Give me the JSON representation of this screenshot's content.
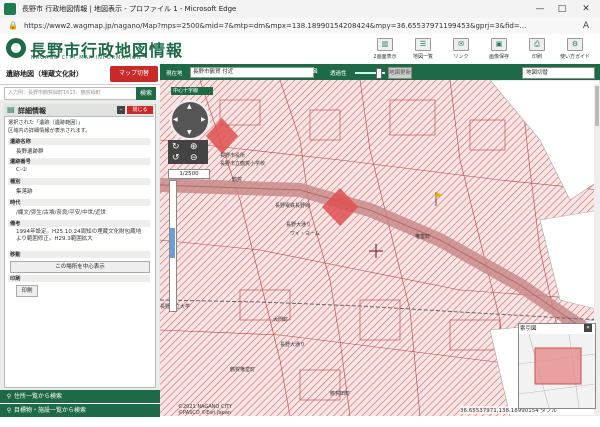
{
  "window": {
    "title": "長野市 行政地図情報 | 地図表示 - プロファイル 1 - Microsoft Edge",
    "minimize": "—",
    "maximize": "□",
    "close": "✕"
  },
  "address_bar": {
    "url": "https://www2.wagmap.jp/nagano/Map?mps=2500&mid=7&mtp=dm&mpx=138.18990154208424&mpy=36.65537971199453&gprj=3&fid=..."
  },
  "header": {
    "logo_title": "長野市行政地図情報",
    "logo_sub": "NAGANO CITY MAP INFORMATION",
    "buttons": [
      {
        "label": "2画面表示",
        "icon": "split-screen-icon"
      },
      {
        "label": "地図一覧",
        "icon": "map-list-icon"
      },
      {
        "label": "リンク",
        "icon": "link-icon"
      },
      {
        "label": "画像保存",
        "icon": "image-save-icon"
      },
      {
        "label": "印刷",
        "icon": "print-icon"
      },
      {
        "label": "使い方ガイド",
        "icon": "guide-icon"
      }
    ]
  },
  "left": {
    "map_type": "遺跡地図（埋蔵文化財）",
    "map_switch": "マップ切替",
    "search_placeholder": "入力例：長野市鶴賀緑町1613、鶴賀緑町",
    "search_button": "検索",
    "detail": {
      "title": "詳細情報",
      "close": "閉じる",
      "intro1": "選択された「遺跡（遺跡範囲）」",
      "intro2": "区域内の詳細情報が表示されます。",
      "fields": [
        {
          "label": "遺跡名称",
          "value": "長野遺跡群"
        },
        {
          "label": "遺跡番号",
          "value": "C-②"
        },
        {
          "label": "種別",
          "value": "集落跡"
        },
        {
          "label": "時代",
          "value": "/縄文/弥生/古墳/奈良/平安/中世/近世"
        },
        {
          "label": "備考",
          "value": "1994年設定。H25.10.24周知の埋蔵文化財包蔵地より範囲修正。H29.3範囲拡大"
        }
      ],
      "move_label": "移動",
      "center_button": "この場所を中心表示",
      "print_label": "印刷",
      "print_button": "印刷"
    },
    "bottom_items": [
      "住所一覧から検索",
      "目標物・施設一覧から検索"
    ]
  },
  "maptools": {
    "addr_label": "現在地",
    "addr_value": "長野市鶴賀 付近",
    "opacity_label": "透過性",
    "display_button": "地図更新",
    "base_select": "地図切替",
    "city_label": "中心十字線",
    "scale": "1/2500"
  },
  "map": {
    "labels": [
      "長野市役所",
      "鶴賀",
      "長野市立鶴賀小学校",
      "長野電鉄長野線",
      "長野大通り",
      "ワイ・ヨーム",
      "長野県立大学",
      "大門町",
      "長野大通り",
      "権堂町",
      "鶴賀権堂町",
      "鶴賀田町"
    ],
    "copyright": "©2021 NAGANO CITY",
    "brand": "©PASCO ©Esri Japan",
    "coords": "36.65537971,138.18990154 ダブル",
    "overview_title": "索引図"
  },
  "colors": {
    "brand_green": "#1e6a46",
    "accent_red": "#c82a2a",
    "map_hatch": "#d96060"
  }
}
